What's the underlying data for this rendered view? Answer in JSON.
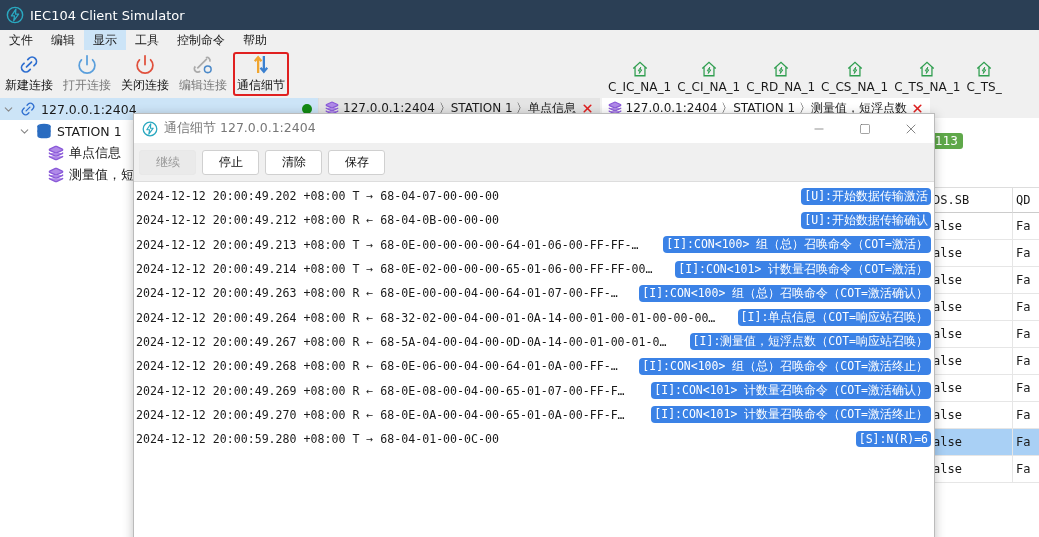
{
  "window": {
    "title": "IEC104 Client Simulator"
  },
  "menu": [
    {
      "label": "文件",
      "selected": false
    },
    {
      "label": "编辑",
      "selected": false
    },
    {
      "label": "显示",
      "selected": true
    },
    {
      "label": "工具",
      "selected": false
    },
    {
      "label": "控制命令",
      "selected": false
    },
    {
      "label": "帮助",
      "selected": false
    }
  ],
  "toolbar": [
    {
      "label": "新建连接",
      "kind": "new",
      "disabled": false,
      "highlighted": false
    },
    {
      "label": "打开连接",
      "kind": "open",
      "disabled": true,
      "highlighted": false
    },
    {
      "label": "关闭连接",
      "kind": "close",
      "disabled": false,
      "highlighted": false
    },
    {
      "label": "编辑连接",
      "kind": "edit",
      "disabled": true,
      "highlighted": false
    },
    {
      "label": "通信细节",
      "kind": "details",
      "disabled": false,
      "highlighted": true
    }
  ],
  "command_buttons": [
    "C_IC_NA_1",
    "C_CI_NA_1",
    "C_RD_NA_1",
    "C_CS_NA_1",
    "C_TS_NA_1",
    "C_TS_"
  ],
  "tree": [
    {
      "label": "127.0.0.1:2404",
      "kind": "connection",
      "selected": true,
      "connected": true,
      "expanded": true,
      "children": [
        {
          "label": "STATION 1",
          "kind": "station",
          "selected": false,
          "expanded": true,
          "children": [
            {
              "label": "单点信息",
              "kind": "data",
              "selected": false
            },
            {
              "label": "测量值，短",
              "kind": "data",
              "selected": false
            }
          ]
        }
      ]
    }
  ],
  "tabs": [
    {
      "label": "127.0.0.1:2404 〉STATION 1 〉单点信息",
      "selected": false
    },
    {
      "label": "127.0.0.1:2404 〉STATION 1 〉测量值，短浮点数",
      "selected": true
    }
  ],
  "badge": "113",
  "table": {
    "columns": [
      "DS.SB",
      "QD"
    ],
    "rows": [
      {
        "cells": [
          "alse",
          "Fa"
        ],
        "selected": false
      },
      {
        "cells": [
          "alse",
          "Fa"
        ],
        "selected": false
      },
      {
        "cells": [
          "alse",
          "Fa"
        ],
        "selected": false
      },
      {
        "cells": [
          "alse",
          "Fa"
        ],
        "selected": false
      },
      {
        "cells": [
          "alse",
          "Fa"
        ],
        "selected": false
      },
      {
        "cells": [
          "alse",
          "Fa"
        ],
        "selected": false
      },
      {
        "cells": [
          "alse",
          "Fa"
        ],
        "selected": false
      },
      {
        "cells": [
          "alse",
          "Fa"
        ],
        "selected": false
      },
      {
        "cells": [
          "alse",
          "Fa"
        ],
        "selected": true
      },
      {
        "cells": [
          "alse",
          "Fa"
        ],
        "selected": false
      }
    ]
  },
  "dialog": {
    "title": "通信细节 127.0.0.1:2404",
    "buttons": [
      {
        "label": "继续",
        "disabled": true
      },
      {
        "label": "停止",
        "disabled": false
      },
      {
        "label": "清除",
        "disabled": false
      },
      {
        "label": "保存",
        "disabled": false
      }
    ],
    "log": [
      {
        "text": "2024-12-12 20:00:49.202 +08:00 T → 68-04-07-00-00-00",
        "tag": "[U]:开始数据传输激活"
      },
      {
        "text": "2024-12-12 20:00:49.212 +08:00 R ← 68-04-0B-00-00-00",
        "tag": "[U]:开始数据传输确认"
      },
      {
        "text": "2024-12-12 20:00:49.213 +08:00 T → 68-0E-00-00-00-00-64-01-06-00-FF-FF-…",
        "tag": "[I]:CON<100> 组（总）召唤命令（COT=激活）"
      },
      {
        "text": "2024-12-12 20:00:49.214 +08:00 T → 68-0E-02-00-00-00-65-01-06-00-FF-FF-00…",
        "tag": "[I]:CON<101> 计数量召唤命令（COT=激活）"
      },
      {
        "text": "2024-12-12 20:00:49.263 +08:00 R ← 68-0E-00-00-04-00-64-01-07-00-FF-…",
        "tag": "[I]:CON<100> 组（总）召唤命令（COT=激活确认）"
      },
      {
        "text": "2024-12-12 20:00:49.264 +08:00 R ← 68-32-02-00-04-00-01-0A-14-00-01-00-01-00-00-00…",
        "tag": "[I]:单点信息（COT=响应站召唤）"
      },
      {
        "text": "2024-12-12 20:00:49.267 +08:00 R ← 68-5A-04-00-04-00-0D-0A-14-00-01-00-01-0…",
        "tag": "[I]:测量值，短浮点数（COT=响应站召唤）"
      },
      {
        "text": "2024-12-12 20:00:49.268 +08:00 R ← 68-0E-06-00-04-00-64-01-0A-00-FF-…",
        "tag": "[I]:CON<100> 组（总）召唤命令（COT=激活终止）"
      },
      {
        "text": "2024-12-12 20:00:49.269 +08:00 R ← 68-0E-08-00-04-00-65-01-07-00-FF-F…",
        "tag": "[I]:CON<101> 计数量召唤命令（COT=激活确认）"
      },
      {
        "text": "2024-12-12 20:00:49.270 +08:00 R ← 68-0E-0A-00-04-00-65-01-0A-00-FF-F…",
        "tag": "[I]:CON<101> 计数量召唤命令（COT=激活终止）"
      },
      {
        "text": "2024-12-12 20:00:59.280 +08:00 T → 68-04-01-00-0C-00",
        "tag": "[S]:N(R)=6"
      }
    ]
  }
}
